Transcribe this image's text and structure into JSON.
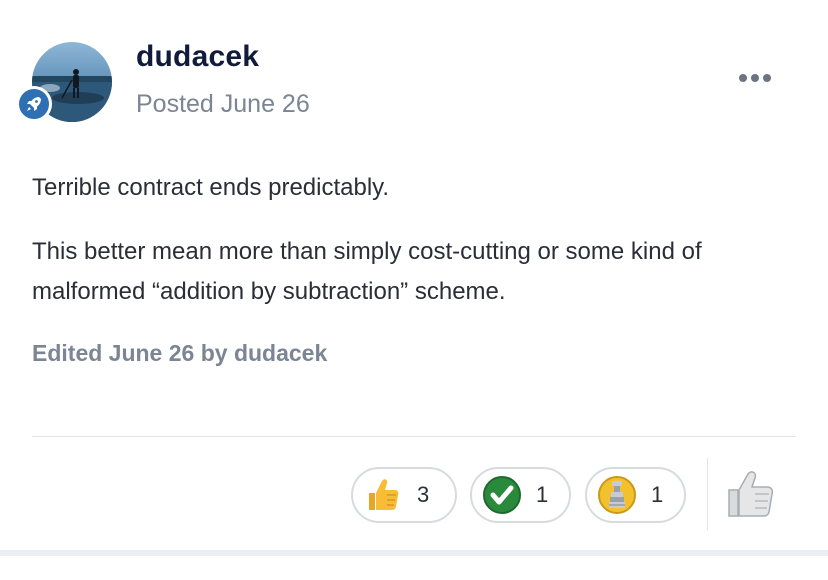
{
  "post": {
    "author": {
      "name": "dudacek",
      "avatar_icon": "hockey-player-photo",
      "rank_badge_icon": "rocket-icon"
    },
    "posted": "Posted June 26",
    "menu_icon": "ellipsis-icon",
    "body": {
      "paragraph_1": "Terrible contract ends predictably.",
      "paragraph_2": "This better mean more than simply cost-cutting or some kind of malformed “addition by subtraction” scheme."
    },
    "edited": "Edited June 26 by dudacek"
  },
  "reactions": [
    {
      "icon": "thumbs-up-icon",
      "count": "3"
    },
    {
      "icon": "checkmark-icon",
      "count": "1"
    },
    {
      "icon": "stanley-cup-icon",
      "count": "1"
    }
  ],
  "react_button_icon": "thumbs-up-outline-icon",
  "colors": {
    "author_name": "#111b3a",
    "muted_text": "#7b8593",
    "body_text": "#2a2e36",
    "badge_blue": "#2f6fb3",
    "check_green": "#2a8a3c"
  }
}
